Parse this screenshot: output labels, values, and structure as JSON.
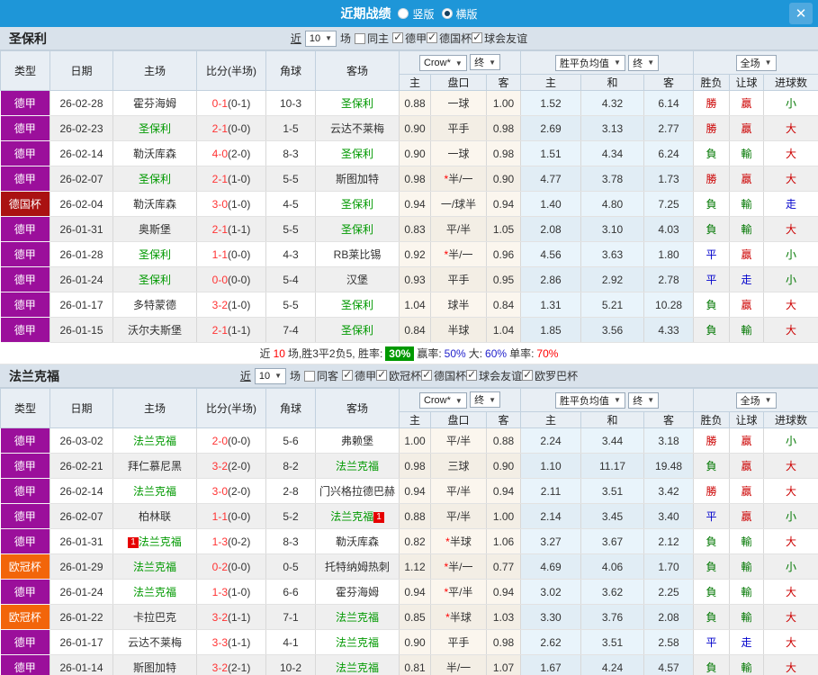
{
  "titlebar": {
    "title": "近期战绩",
    "vertical": "竖版",
    "horizontal": "横版",
    "close": "✕"
  },
  "filter_words": {
    "near": "近",
    "games_count": "10",
    "games": "场"
  },
  "dropdowns": {
    "company": "Crow*",
    "final": "终",
    "avg": "胜平负均值",
    "scope": "全场"
  },
  "header": {
    "type": "类型",
    "date": "日期",
    "home": "主场",
    "score": "比分(半场)",
    "corner": "角球",
    "away": "客场",
    "h": "主",
    "line": "盘口",
    "a": "客",
    "avg_h": "主",
    "avg_d": "和",
    "avg_a": "客",
    "result": "胜负",
    "handicap": "让球",
    "goals": "进球数"
  },
  "sections": [
    {
      "team": "圣保利",
      "same": {
        "label": "同主",
        "checked": false
      },
      "leagues": [
        {
          "label": "德甲",
          "checked": true
        },
        {
          "label": "德国杯",
          "checked": true
        },
        {
          "label": "球会友谊",
          "checked": true
        }
      ],
      "rows": [
        {
          "league": "德甲",
          "lc": "purple",
          "date": "26-02-28",
          "home": "霍芬海姆",
          "hg": false,
          "away": "圣保利",
          "ag": true,
          "score": "0-1",
          "half": "(0-1)",
          "corner": "10-3",
          "oh": "0.88",
          "line": "一球",
          "oa": "1.00",
          "ah": "1.52",
          "ad": "4.32",
          "aa": "6.14",
          "res": "勝",
          "hcp": "贏",
          "gls": "小"
        },
        {
          "league": "德甲",
          "lc": "purple",
          "date": "26-02-23",
          "home": "圣保利",
          "hg": true,
          "away": "云达不莱梅",
          "ag": false,
          "score": "2-1",
          "half": "(0-0)",
          "corner": "1-5",
          "oh": "0.90",
          "line": "平手",
          "oa": "0.98",
          "ah": "2.69",
          "ad": "3.13",
          "aa": "2.77",
          "res": "勝",
          "hcp": "贏",
          "gls": "大"
        },
        {
          "league": "德甲",
          "lc": "purple",
          "date": "26-02-14",
          "home": "勒沃库森",
          "hg": false,
          "away": "圣保利",
          "ag": true,
          "score": "4-0",
          "half": "(2-0)",
          "corner": "8-3",
          "oh": "0.90",
          "line": "一球",
          "oa": "0.98",
          "ah": "1.51",
          "ad": "4.34",
          "aa": "6.24",
          "res": "負",
          "hcp": "輸",
          "gls": "大"
        },
        {
          "league": "德甲",
          "lc": "purple",
          "date": "26-02-07",
          "home": "圣保利",
          "hg": true,
          "away": "斯图加特",
          "ag": false,
          "score": "2-1",
          "half": "(1-0)",
          "corner": "5-5",
          "oh": "0.98",
          "line": "*半/一",
          "oa": "0.90",
          "ah": "4.77",
          "ad": "3.78",
          "aa": "1.73",
          "res": "勝",
          "hcp": "贏",
          "gls": "大"
        },
        {
          "league": "德国杯",
          "lc": "darkred",
          "date": "26-02-04",
          "home": "勒沃库森",
          "hg": false,
          "away": "圣保利",
          "ag": true,
          "score": "3-0",
          "half": "(1-0)",
          "corner": "4-5",
          "oh": "0.94",
          "line": "一/球半",
          "oa": "0.94",
          "ah": "1.40",
          "ad": "4.80",
          "aa": "7.25",
          "res": "負",
          "hcp": "輸",
          "gls": "走"
        },
        {
          "league": "德甲",
          "lc": "purple",
          "date": "26-01-31",
          "home": "奥斯堡",
          "hg": false,
          "away": "圣保利",
          "ag": true,
          "score": "2-1",
          "half": "(1-1)",
          "corner": "5-5",
          "oh": "0.83",
          "line": "平/半",
          "oa": "1.05",
          "ah": "2.08",
          "ad": "3.10",
          "aa": "4.03",
          "res": "負",
          "hcp": "輸",
          "gls": "大"
        },
        {
          "league": "德甲",
          "lc": "purple",
          "date": "26-01-28",
          "home": "圣保利",
          "hg": true,
          "away": "RB莱比锡",
          "ag": false,
          "score": "1-1",
          "half": "(0-0)",
          "corner": "4-3",
          "oh": "0.92",
          "line": "*半/一",
          "oa": "0.96",
          "ah": "4.56",
          "ad": "3.63",
          "aa": "1.80",
          "res": "平",
          "hcp": "贏",
          "gls": "小"
        },
        {
          "league": "德甲",
          "lc": "purple",
          "date": "26-01-24",
          "home": "圣保利",
          "hg": true,
          "away": "汉堡",
          "ag": false,
          "score": "0-0",
          "half": "(0-0)",
          "corner": "5-4",
          "oh": "0.93",
          "line": "平手",
          "oa": "0.95",
          "ah": "2.86",
          "ad": "2.92",
          "aa": "2.78",
          "res": "平",
          "hcp": "走",
          "gls": "小"
        },
        {
          "league": "德甲",
          "lc": "purple",
          "date": "26-01-17",
          "home": "多特蒙德",
          "hg": false,
          "away": "圣保利",
          "ag": true,
          "score": "3-2",
          "half": "(1-0)",
          "corner": "5-5",
          "oh": "1.04",
          "line": "球半",
          "oa": "0.84",
          "ah": "1.31",
          "ad": "5.21",
          "aa": "10.28",
          "res": "負",
          "hcp": "贏",
          "gls": "大"
        },
        {
          "league": "德甲",
          "lc": "purple",
          "date": "26-01-15",
          "home": "沃尔夫斯堡",
          "hg": false,
          "away": "圣保利",
          "ag": true,
          "score": "2-1",
          "half": "(1-1)",
          "corner": "7-4",
          "oh": "0.84",
          "line": "半球",
          "oa": "1.04",
          "ah": "1.85",
          "ad": "3.56",
          "aa": "4.33",
          "res": "負",
          "hcp": "輸",
          "gls": "大"
        }
      ],
      "summary": {
        "t1": "近",
        "num": "10",
        "t2": "场,胜3平2负5, 胜率:",
        "rate": "30%",
        "t3": "赢率:",
        "win": "50%",
        "t4": "大:",
        "big": "60%",
        "t5": "单率:",
        "single": "70%"
      }
    },
    {
      "team": "法兰克福",
      "same": {
        "label": "同客",
        "checked": false
      },
      "leagues": [
        {
          "label": "德甲",
          "checked": true
        },
        {
          "label": "欧冠杯",
          "checked": true
        },
        {
          "label": "德国杯",
          "checked": true
        },
        {
          "label": "球会友谊",
          "checked": true
        },
        {
          "label": "欧罗巴杯",
          "checked": true
        }
      ],
      "rows": [
        {
          "league": "德甲",
          "lc": "purple",
          "date": "26-03-02",
          "home": "法兰克福",
          "hg": true,
          "away": "弗赖堡",
          "ag": false,
          "score": "2-0",
          "half": "(0-0)",
          "corner": "5-6",
          "oh": "1.00",
          "line": "平/半",
          "oa": "0.88",
          "ah": "2.24",
          "ad": "3.44",
          "aa": "3.18",
          "res": "勝",
          "hcp": "贏",
          "gls": "小"
        },
        {
          "league": "德甲",
          "lc": "purple",
          "date": "26-02-21",
          "home": "拜仁慕尼黑",
          "hg": false,
          "away": "法兰克福",
          "ag": true,
          "score": "3-2",
          "half": "(2-0)",
          "corner": "8-2",
          "oh": "0.98",
          "line": "三球",
          "oa": "0.90",
          "ah": "1.10",
          "ad": "11.17",
          "aa": "19.48",
          "res": "負",
          "hcp": "贏",
          "gls": "大"
        },
        {
          "league": "德甲",
          "lc": "purple",
          "date": "26-02-14",
          "home": "法兰克福",
          "hg": true,
          "away": "门兴格拉德巴赫",
          "ag": false,
          "score": "3-0",
          "half": "(2-0)",
          "corner": "2-8",
          "oh": "0.94",
          "line": "平/半",
          "oa": "0.94",
          "ah": "2.11",
          "ad": "3.51",
          "aa": "3.42",
          "res": "勝",
          "hcp": "贏",
          "gls": "大"
        },
        {
          "league": "德甲",
          "lc": "purple",
          "date": "26-02-07",
          "home": "柏林联",
          "hg": false,
          "away": "法兰克福",
          "ag": true,
          "aba": "1",
          "score": "1-1",
          "half": "(0-0)",
          "corner": "5-2",
          "oh": "0.88",
          "line": "平/半",
          "oa": "1.00",
          "ah": "2.14",
          "ad": "3.45",
          "aa": "3.40",
          "res": "平",
          "hcp": "贏",
          "gls": "小"
        },
        {
          "league": "德甲",
          "lc": "purple",
          "date": "26-01-31",
          "home": "法兰克福",
          "hg": true,
          "hbb": "1",
          "away": "勒沃库森",
          "ag": false,
          "score": "1-3",
          "half": "(0-2)",
          "corner": "8-3",
          "oh": "0.82",
          "line": "*半球",
          "oa": "1.06",
          "ah": "3.27",
          "ad": "3.67",
          "aa": "2.12",
          "res": "負",
          "hcp": "輸",
          "gls": "大"
        },
        {
          "league": "欧冠杯",
          "lc": "orange",
          "date": "26-01-29",
          "home": "法兰克福",
          "hg": true,
          "away": "托特纳姆热刺",
          "ag": false,
          "score": "0-2",
          "half": "(0-0)",
          "corner": "0-5",
          "oh": "1.12",
          "line": "*半/一",
          "oa": "0.77",
          "ah": "4.69",
          "ad": "4.06",
          "aa": "1.70",
          "res": "負",
          "hcp": "輸",
          "gls": "小"
        },
        {
          "league": "德甲",
          "lc": "purple",
          "date": "26-01-24",
          "home": "法兰克福",
          "hg": true,
          "away": "霍芬海姆",
          "ag": false,
          "score": "1-3",
          "half": "(1-0)",
          "corner": "6-6",
          "oh": "0.94",
          "line": "*平/半",
          "oa": "0.94",
          "ah": "3.02",
          "ad": "3.62",
          "aa": "2.25",
          "res": "負",
          "hcp": "輸",
          "gls": "大"
        },
        {
          "league": "欧冠杯",
          "lc": "orange",
          "date": "26-01-22",
          "home": "卡拉巴克",
          "hg": false,
          "away": "法兰克福",
          "ag": true,
          "score": "3-2",
          "half": "(1-1)",
          "corner": "7-1",
          "oh": "0.85",
          "line": "*半球",
          "oa": "1.03",
          "ah": "3.30",
          "ad": "3.76",
          "aa": "2.08",
          "res": "負",
          "hcp": "輸",
          "gls": "大"
        },
        {
          "league": "德甲",
          "lc": "purple",
          "date": "26-01-17",
          "home": "云达不莱梅",
          "hg": false,
          "away": "法兰克福",
          "ag": true,
          "score": "3-3",
          "half": "(1-1)",
          "corner": "4-1",
          "oh": "0.90",
          "line": "平手",
          "oa": "0.98",
          "ah": "2.62",
          "ad": "3.51",
          "aa": "2.58",
          "res": "平",
          "hcp": "走",
          "gls": "大"
        },
        {
          "league": "德甲",
          "lc": "purple",
          "date": "26-01-14",
          "home": "斯图加特",
          "hg": false,
          "away": "法兰克福",
          "ag": true,
          "score": "3-2",
          "half": "(2-1)",
          "corner": "10-2",
          "oh": "0.81",
          "line": "半/一",
          "oa": "1.07",
          "ah": "1.67",
          "ad": "4.24",
          "aa": "4.57",
          "res": "負",
          "hcp": "輸",
          "gls": "大"
        }
      ]
    }
  ]
}
